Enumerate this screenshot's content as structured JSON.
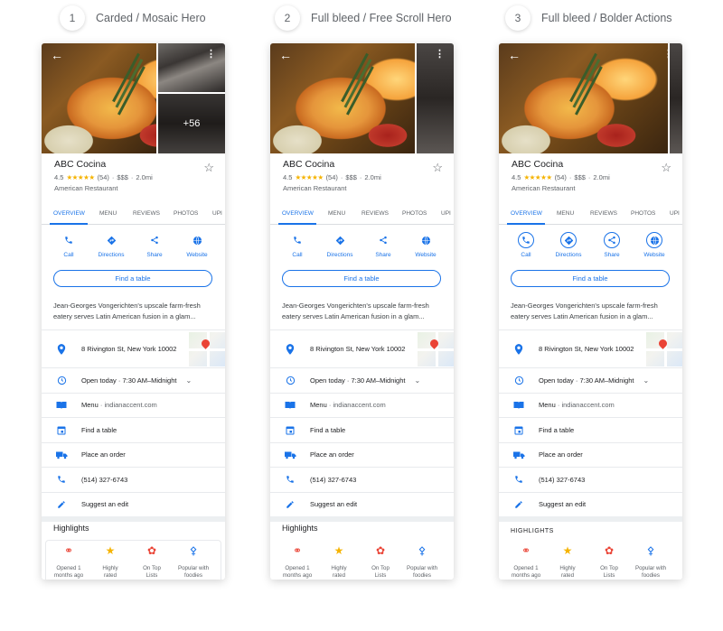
{
  "labels": [
    {
      "num": "1",
      "text": "Carded / Mosaic Hero"
    },
    {
      "num": "2",
      "text": "Full bleed / Free Scroll Hero"
    },
    {
      "num": "3",
      "text": "Full bleed / Bolder Actions"
    }
  ],
  "place": {
    "name": "ABC Cocina",
    "rating": "4.5",
    "stars": "★★★★★",
    "reviews": "(54)",
    "price": "$$$",
    "distance": "2.0mi",
    "category": "American Restaurant",
    "more_photos": "+56"
  },
  "tabs": [
    "OVERVIEW",
    "MENU",
    "REVIEWS",
    "PHOTOS",
    "UPI"
  ],
  "actions": [
    {
      "label": "Call",
      "icon": "phone-icon"
    },
    {
      "label": "Directions",
      "icon": "directions-icon"
    },
    {
      "label": "Share",
      "icon": "share-icon"
    },
    {
      "label": "Website",
      "icon": "globe-icon"
    }
  ],
  "find_table_button": "Find a table",
  "description": "Jean-Georges Vongerichten's upscale farm-fresh eatery serves Latin American fusion in a glam...",
  "rows": {
    "address": "8 Rivington St, New York 10002",
    "hours": "Open today · 7:30 AM–Midnight",
    "menu": "Menu",
    "menu_url": "indianaccent.com",
    "find_table": "Find a table",
    "order": "Place an order",
    "phone": "(514) 327-6743",
    "suggest": "Suggest an edit"
  },
  "map_label": "dison are P",
  "highlights_title": "Highlights",
  "highlights_title_caps": "HIGHLIGHTS",
  "highlights": [
    {
      "line1": "Opened 1",
      "line2": "months ago",
      "icon": "bicycle-icon"
    },
    {
      "line1": "Highly",
      "line2": "rated",
      "icon": "star-icon"
    },
    {
      "line1": "On Top",
      "line2": "Lists",
      "icon": "award-ribbon-icon"
    },
    {
      "line1": "Popular with",
      "line2": "foodies",
      "icon": "utensils-icon"
    }
  ],
  "colors": {
    "accent": "#1a73e8",
    "star": "#f5b300",
    "pin": "#ea4335"
  }
}
